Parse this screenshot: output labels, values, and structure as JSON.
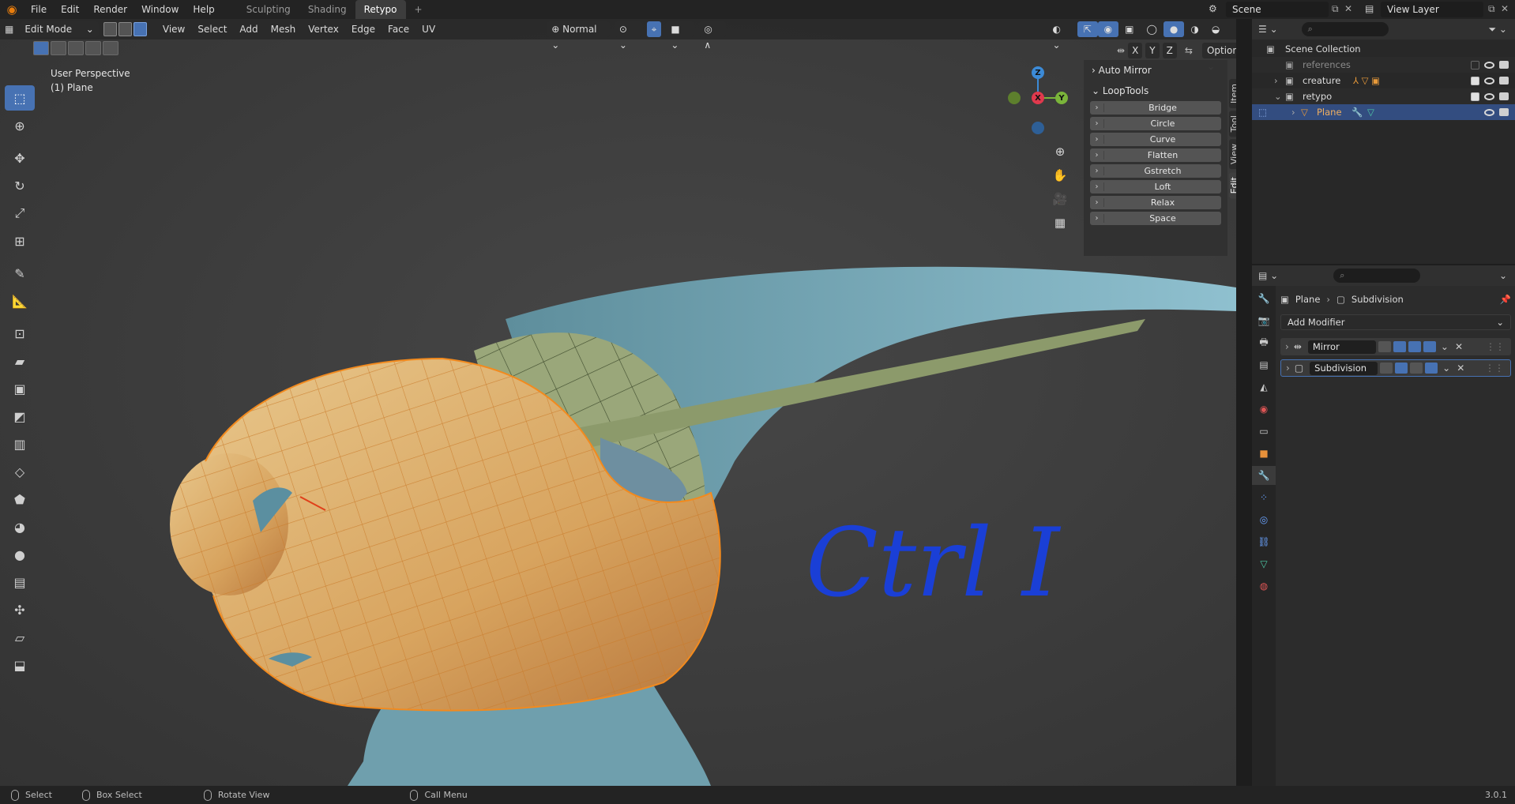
{
  "topbar": {
    "menus": [
      "File",
      "Edit",
      "Render",
      "Window",
      "Help"
    ],
    "workspaces": [
      "Sculpting",
      "Shading",
      "Retypo"
    ],
    "active_workspace": "Retypo",
    "add_tab": "+",
    "scene": "Scene",
    "view_layer": "View Layer"
  },
  "viewport_header": {
    "mode": "Edit Mode",
    "menus": [
      "View",
      "Select",
      "Add",
      "Mesh",
      "Vertex",
      "Edge",
      "Face",
      "UV"
    ],
    "orientation": "Normal",
    "mirror_axes": [
      "X",
      "Y",
      "Z"
    ],
    "options": "Options"
  },
  "overlay": {
    "perspective": "User Perspective",
    "object": "(1) Plane"
  },
  "gizmo": {
    "x": "X",
    "y": "Y",
    "z": "Z"
  },
  "npanel": {
    "auto_mirror": "Auto Mirror",
    "looptools": "LoopTools",
    "buttons": [
      "Bridge",
      "Circle",
      "Curve",
      "Flatten",
      "Gstretch",
      "Loft",
      "Relax",
      "Space"
    ],
    "tabs": [
      "Item",
      "Tool",
      "View",
      "Edit"
    ]
  },
  "annotation": "Ctrl I",
  "outliner": {
    "root": "Scene Collection",
    "items": [
      {
        "name": "references",
        "indent": 1
      },
      {
        "name": "creature",
        "indent": 1
      },
      {
        "name": "retypo",
        "indent": 1
      },
      {
        "name": "Plane",
        "indent": 2
      }
    ]
  },
  "properties": {
    "breadcrumb_object": "Plane",
    "breadcrumb_modifier": "Subdivision",
    "add_modifier": "Add Modifier",
    "modifiers": [
      "Mirror",
      "Subdivision"
    ]
  },
  "statusbar": {
    "select": "Select",
    "box_select": "Box Select",
    "rotate_view": "Rotate View",
    "call_menu": "Call Menu",
    "version": "3.0.1"
  },
  "colors": {
    "accent": "#4772b3",
    "mesh_orange": "#e8a04a",
    "model_teal": "#7fb3c2",
    "annotation_blue": "#1a3fd6"
  }
}
